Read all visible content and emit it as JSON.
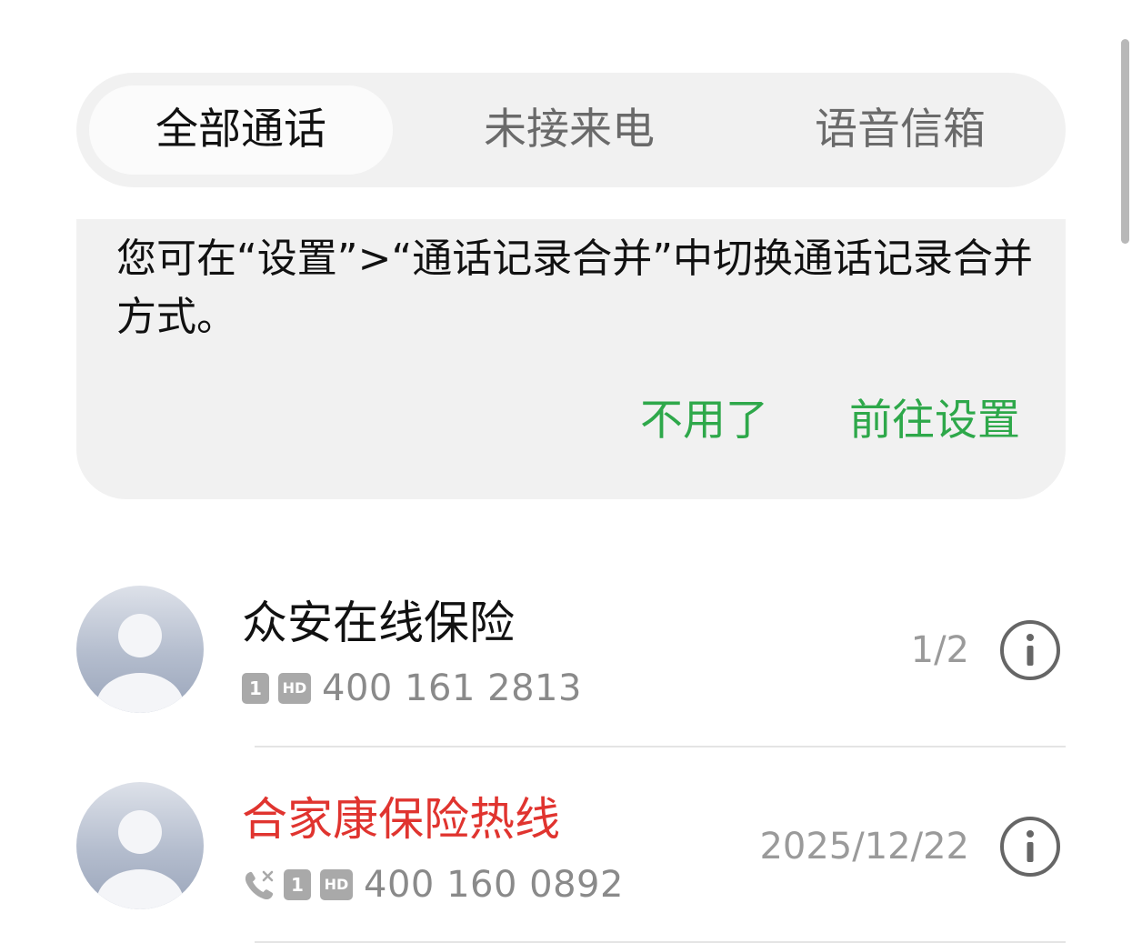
{
  "tabs": [
    {
      "label": "全部通话",
      "active": true
    },
    {
      "label": "未接来电",
      "active": false
    },
    {
      "label": "语音信箱",
      "active": false
    }
  ],
  "notice": {
    "text": "您可在“设置”>“通话记录合并”中切换通话记录合并方式。",
    "dismiss_label": "不用了",
    "goto_label": "前往设置",
    "accent_color": "#2ea84a"
  },
  "calls": [
    {
      "name": "众安在线保险",
      "missed": false,
      "sim": "1",
      "hd": "HD",
      "number": "400 161 2813",
      "side": "1/2",
      "icons": [
        "sim-1-icon",
        "hd-icon",
        "info-icon"
      ]
    },
    {
      "name": "合家康保险热线",
      "missed": true,
      "sim": "1",
      "hd": "HD",
      "number": "400 160 0892",
      "side": "2025/12/22",
      "icons": [
        "missed-call-icon",
        "sim-1-icon",
        "hd-icon",
        "info-icon"
      ],
      "name_color": "#e0342f"
    }
  ]
}
